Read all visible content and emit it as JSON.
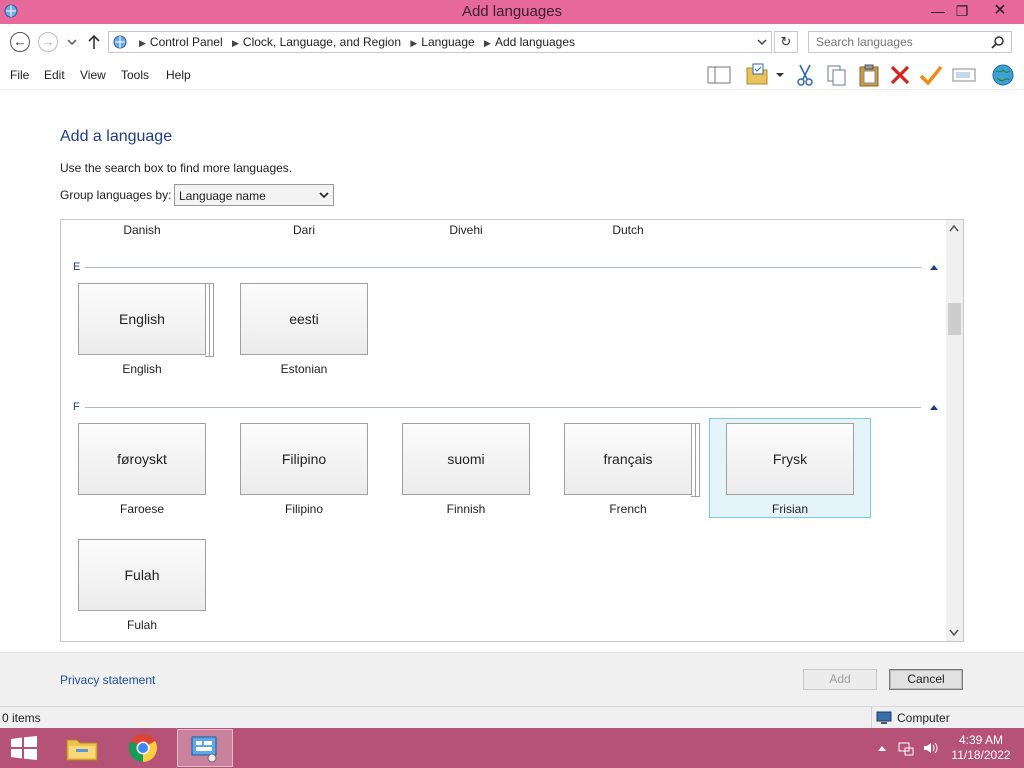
{
  "window": {
    "title": "Add languages"
  },
  "address": {
    "crumbs": [
      "Control Panel",
      "Clock, Language, and Region",
      "Language",
      "Add languages"
    ]
  },
  "search": {
    "placeholder": "Search languages"
  },
  "menu": {
    "items": [
      "File",
      "Edit",
      "View",
      "Tools",
      "Help"
    ]
  },
  "toolbar": {
    "icons": [
      "panel-icon",
      "properties-icon",
      "dropdown-icon",
      "cut-icon",
      "copy-icon",
      "paste-icon",
      "delete-icon",
      "check-icon",
      "rename-icon",
      "globe-icon"
    ]
  },
  "content": {
    "heading": "Add a language",
    "hint": "Use the search box to find more languages.",
    "group_label": "Group languages by:",
    "group_value": "Language name"
  },
  "list": {
    "top_row": [
      "Danish",
      "Dari",
      "Divehi",
      "Dutch"
    ],
    "groups": [
      {
        "letter": "E",
        "tiles": [
          {
            "native": "English",
            "name": "English",
            "multi": true
          },
          {
            "native": "eesti",
            "name": "Estonian",
            "multi": false
          }
        ]
      },
      {
        "letter": "F",
        "tiles": [
          {
            "native": "føroyskt",
            "name": "Faroese",
            "multi": false
          },
          {
            "native": "Filipino",
            "name": "Filipino",
            "multi": false
          },
          {
            "native": "suomi",
            "name": "Finnish",
            "multi": false
          },
          {
            "native": "français",
            "name": "French",
            "multi": true
          },
          {
            "native": "Frysk",
            "name": "Frisian",
            "multi": false,
            "selected": true
          },
          {
            "native": "Fulah",
            "name": "Fulah",
            "multi": false
          }
        ]
      }
    ]
  },
  "footer": {
    "privacy": "Privacy statement",
    "add": "Add",
    "cancel": "Cancel"
  },
  "status": {
    "items": "0 items",
    "location": "Computer"
  },
  "taskbar": {
    "time": "4:39 AM",
    "date": "11/18/2022"
  },
  "colors": {
    "titlebar": "#e7689a",
    "taskbar": "#b55276",
    "heading": "#1e3c8c",
    "selection": "#e5f3fb"
  }
}
